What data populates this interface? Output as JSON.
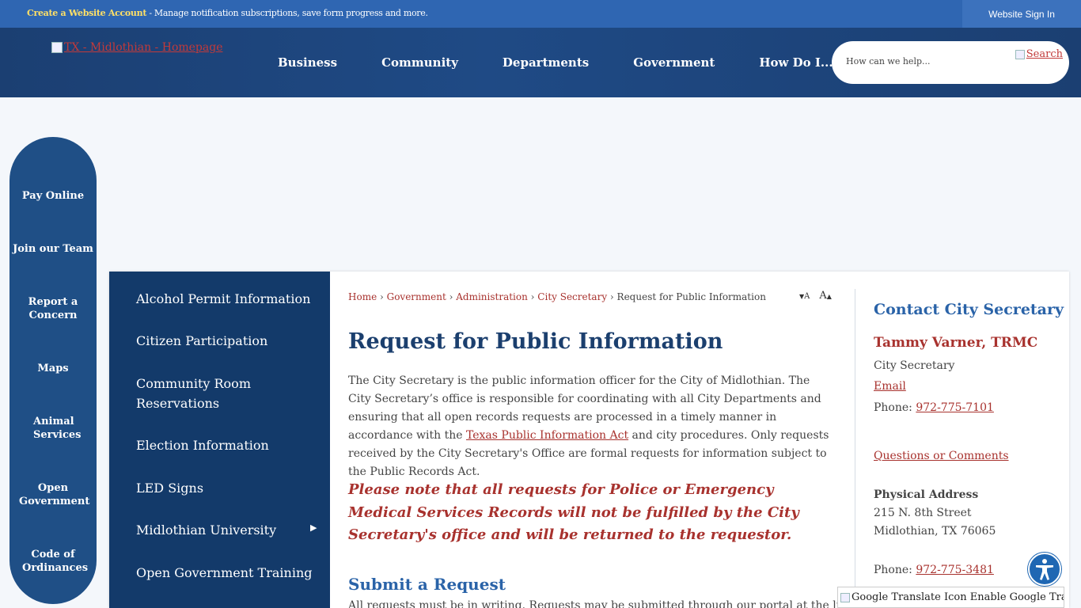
{
  "topbar": {
    "create_account": "Create a Website Account",
    "message": " - Manage notification subscriptions, save form progress and more.",
    "signin": "Website Sign In"
  },
  "header": {
    "logo_alt": "TX - Midlothian - Homepage",
    "nav": [
      "Business",
      "Community",
      "Departments",
      "Government",
      "How Do I..."
    ],
    "search_placeholder": "How can we help...",
    "search_button": "Search"
  },
  "quick_links": [
    "Pay Online",
    "Join our Team",
    "Report a Concern",
    "Maps",
    "Animal Services",
    "Open Government",
    "Code of Ordinances"
  ],
  "subnav": [
    "Alcohol Permit Information",
    "Citizen Participation",
    "Community Room Reservations",
    "Election Information",
    "LED Signs",
    "Midlothian University",
    "Open Government Training"
  ],
  "breadcrumb": {
    "items": [
      "Home",
      "Government",
      "Administration",
      "City Secretary"
    ],
    "current": "Request for Public Information",
    "sep": " › "
  },
  "text_size": {
    "decrease": "A",
    "increase": "A"
  },
  "main": {
    "title": "Request for Public Information",
    "intro_1": "The City Secretary is the public information officer for the City of Midlothian. The City Secretary’s office is responsible for coordinating with all City Departments and ensuring that all open records requests are processed in a timely manner in accordance with the ",
    "intro_link": "Texas Public Information Act",
    "intro_2": " and city procedures.  Only requests received by the City Secretary's Office are formal requests for information subject to the Public Records Act.",
    "notice": "Please note that all requests for Police or Emergency Medical Services Records will not be fulfilled by the City Secretary's office and will be returned to the requestor.",
    "subhead": "Submit a Request",
    "cutoff": "All requests must be in writing.  Requests may be submitted through our portal at the link below:"
  },
  "contact": {
    "title": "Contact City Secretary",
    "name": "Tammy Varner, TRMC",
    "role": "City Secretary",
    "email": "Email",
    "phone_label": "Phone: ",
    "phone": "972-775-7101",
    "questions": "Questions or Comments",
    "address_label": "Physical Address",
    "address_1": "215 N. 8th Street",
    "address_2": "Midlothian, TX 76065",
    "phone2_label": "Phone: ",
    "phone2": "972-775-3481"
  },
  "translate": "Google Translate Icon Enable Google Translate",
  "colors": {
    "brand_blue": "#1f4f86",
    "accent_red": "#a8322e",
    "topbar": "#2f66b2"
  }
}
